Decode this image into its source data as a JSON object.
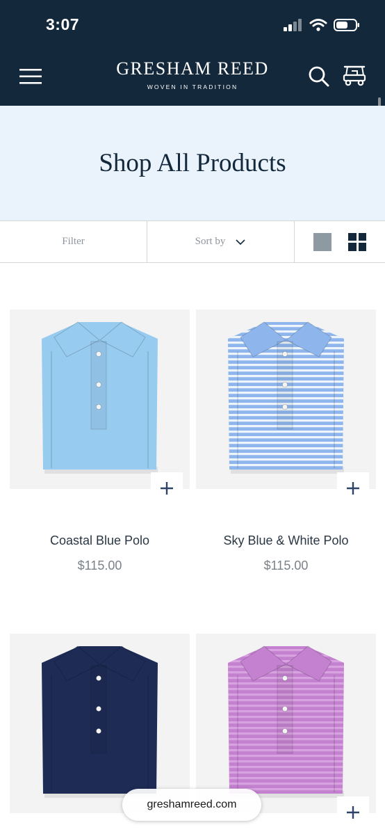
{
  "status_bar": {
    "time": "3:07"
  },
  "header": {
    "brand_name": "GRESHAM REED",
    "brand_tagline": "WOVEN IN TRADITION",
    "icons": [
      "menu-icon",
      "search-icon",
      "golf-cart-icon"
    ],
    "background_color": "#13283a"
  },
  "hero": {
    "title": "Shop All Products",
    "background_color": "#eaf2fc"
  },
  "toolbar": {
    "filter_label": "Filter",
    "sort_label": "Sort by",
    "view_options": [
      "single-column-view",
      "grid-view"
    ],
    "selected_view": "grid-view"
  },
  "products": [
    {
      "name": "Coastal Blue Polo",
      "price": "$115.00",
      "shirt_color": "#98cbf0",
      "stripe_color": ""
    },
    {
      "name": "Sky Blue & White Polo",
      "price": "$115.00",
      "shirt_color": "#8fb6ec",
      "stripe_color": "#ffffff"
    },
    {
      "name": "",
      "price": "",
      "shirt_color": "#1e2b55",
      "stripe_color": ""
    },
    {
      "name": "",
      "price": "",
      "shirt_color": "#c381cf",
      "stripe_color": "#dca9e3"
    }
  ],
  "browser": {
    "url": "greshamreed.com"
  }
}
